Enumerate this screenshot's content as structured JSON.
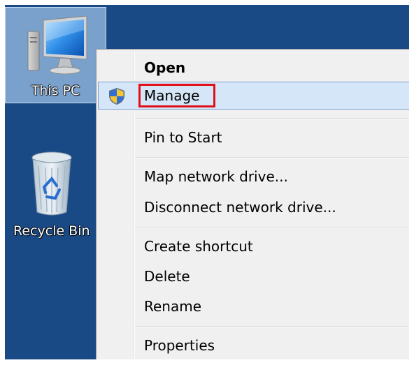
{
  "desktop": {
    "icons": [
      {
        "label": "This PC",
        "icon": "computer-icon",
        "selected": true
      },
      {
        "label": "Recycle Bin",
        "icon": "recycle-bin-icon",
        "selected": false
      }
    ]
  },
  "context_menu": {
    "items": [
      {
        "label": "Open",
        "bold": true
      },
      {
        "label": "Manage",
        "icon": "uac-shield-icon",
        "highlighted": true
      },
      {
        "label": "Pin to Start"
      },
      {
        "label": "Map network drive..."
      },
      {
        "label": "Disconnect network drive..."
      },
      {
        "label": "Create shortcut"
      },
      {
        "label": "Delete"
      },
      {
        "label": "Rename"
      },
      {
        "label": "Properties"
      }
    ]
  },
  "colors": {
    "desktop_bg": "#1a4a86",
    "menu_bg": "#f0f0f0",
    "hover_bg": "#d5e6f8",
    "hover_border": "#7da2ce",
    "callout_red": "#e0101a"
  }
}
